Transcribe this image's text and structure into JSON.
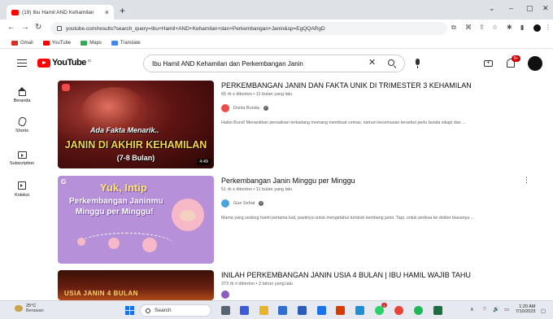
{
  "browser": {
    "tab_title": "(19) Ibu Hamil AND Kehamilan",
    "new_tab": "+",
    "tab_close": "×",
    "url": "youtube.com/results?search_query=Ibu+Hamil+AND+Kehamilan+dan+Perkembangan+Janin&sp=EgQQARgD",
    "window_controls": [
      "⌄",
      "–",
      "▢",
      "✕"
    ],
    "bookmarks": [
      {
        "label": "Gmail",
        "color": "#d93025"
      },
      {
        "label": "YouTube",
        "color": "#ff0000"
      },
      {
        "label": "Maps",
        "color": "#34a853"
      },
      {
        "label": "Translate",
        "color": "#4285f4"
      }
    ]
  },
  "youtube": {
    "logo_text": "YouTube",
    "logo_country": "ID",
    "search_value": "Ibu Hamil AND Kehamilan dan Perkembangan Janin",
    "notification_count": "9+",
    "sidebar": [
      {
        "label": "Beranda",
        "icon": "home-icon"
      },
      {
        "label": "Shorts",
        "icon": "shorts-icon"
      },
      {
        "label": "Subscription",
        "icon": "subscriptions-icon"
      },
      {
        "label": "Koleksi",
        "icon": "library-icon"
      }
    ],
    "results": [
      {
        "title": "PERKEMBANGAN JANIN DAN FAKTA UNIK DI TRIMESTER 3 KEHAMILAN",
        "meta": "65 rb x ditonton • 11 bulan yang lalu",
        "channel": "Dunia Bunda",
        "channel_color": "#f04a4a",
        "description": "Haloo Bund! Menantikan persalinan terkadang memang membuat cemas, namun kecemasan tersebut perlu bunda sikapi dan ...",
        "duration": "4:49",
        "thumb_text": [
          "Ada Fakta Menarik..",
          "JANIN DI AKHIR KEHAMILAN",
          "(7-8 Bulan)"
        ]
      },
      {
        "title": "Perkembangan Janin Minggu per Minggu",
        "meta": "51 rb x ditonton • 11 bulan yang lalu",
        "channel": "Gue Sehat",
        "channel_color": "#4aa3df",
        "description": "Mama yang sedang hamil pertama kali, pastinya untuk mengetahui tumbuh kembang janin. Tapi, untuk periksa ke dokter biasanya ...",
        "duration": "",
        "thumb_text": [
          "G",
          "Yuk, Intip",
          "Perkembangan Janinmu",
          "Minggu per Minggu!"
        ]
      },
      {
        "title": "INILAH PERKEMBANGAN JANIN USIA 4 BULAN | IBU HAMIL WAJIB TAHU",
        "meta": "373 rb x ditonton • 2 tahun yang lalu",
        "channel": "",
        "channel_color": "#8a5cc0",
        "description": "",
        "duration": "",
        "thumb_text": [
          "USIA JANIN 4 BULAN"
        ]
      }
    ],
    "kebab": "⋮"
  },
  "taskbar": {
    "weather_temp": "25°C",
    "weather_cond": "Berawan",
    "search_label": "Search",
    "apps": [
      {
        "name": "file-icon",
        "color": "#5a6470"
      },
      {
        "name": "chat-icon",
        "color": "#3b5bdb"
      },
      {
        "name": "explorer-icon",
        "color": "#e8b52a"
      },
      {
        "name": "store-icon",
        "color": "#2f6fd0"
      },
      {
        "name": "word-icon",
        "color": "#2b5db8"
      },
      {
        "name": "mail-icon",
        "color": "#1a73e8"
      },
      {
        "name": "office-icon",
        "color": "#d83b01"
      },
      {
        "name": "edge-icon",
        "color": "#1e8fd0"
      },
      {
        "name": "whatsapp-icon",
        "color": "#25d366"
      },
      {
        "name": "chrome-icon",
        "color": "#ea4335"
      },
      {
        "name": "spotify-icon",
        "color": "#1db954"
      },
      {
        "name": "excel-icon",
        "color": "#1d6f42"
      }
    ],
    "app_badge": "1",
    "tray": [
      "∧",
      "⌔",
      "🔊",
      "▭"
    ],
    "clock_time": "1:20 AM",
    "clock_date": "7/10/2023"
  }
}
